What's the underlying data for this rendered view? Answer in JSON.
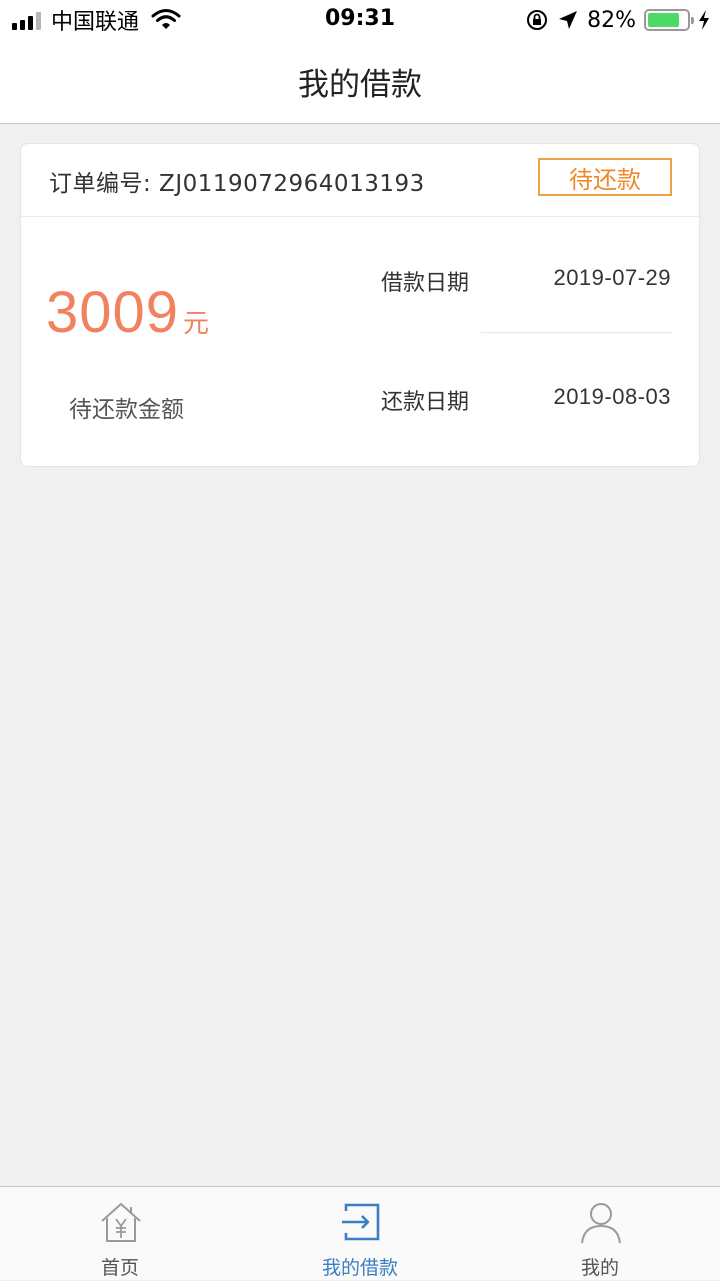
{
  "status_bar": {
    "carrier": "中国联通",
    "time": "09:31",
    "battery_text": "82%",
    "battery_level": 0.82
  },
  "header": {
    "title": "我的借款"
  },
  "loan_card": {
    "order_label": "订单编号: ZJ0119072964013193",
    "status": "待还款",
    "amount": "3009",
    "amount_unit": "元",
    "amount_label": "待还款金额",
    "loan_date_label": "借款日期",
    "loan_date": "2019-07-29",
    "repay_date_label": "还款日期",
    "repay_date": "2019-08-03"
  },
  "tabbar": {
    "items": [
      {
        "label": "首页",
        "icon": "home-icon",
        "active": false
      },
      {
        "label": "我的借款",
        "icon": "loan-icon",
        "active": true
      },
      {
        "label": "我的",
        "icon": "user-icon",
        "active": false
      }
    ]
  },
  "colors": {
    "accent": "#f2825f",
    "status_border": "#f0a04a",
    "tab_active": "#3a7fc2",
    "tab_inactive": "#9a9a9a",
    "background": "#f0f0f0"
  }
}
